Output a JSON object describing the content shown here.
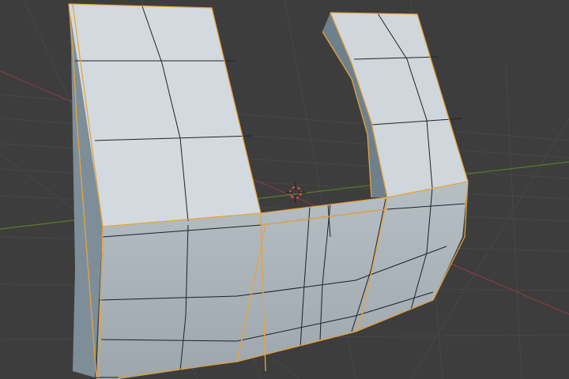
{
  "viewport": {
    "background": "#3d3d3d",
    "grid_color": "#474747",
    "x_axis_color": "#8a3a44",
    "y_axis_color": "#5b7a2c",
    "mesh_face_color": "#d3dadf",
    "mesh_side_color": "#7d8e99",
    "mesh_edge_color": "#1e2226",
    "selection_outline_color": "#e8a33c",
    "cursor_color": "#d9534f",
    "object": "mesh",
    "mode": "edit",
    "selection": "all"
  }
}
